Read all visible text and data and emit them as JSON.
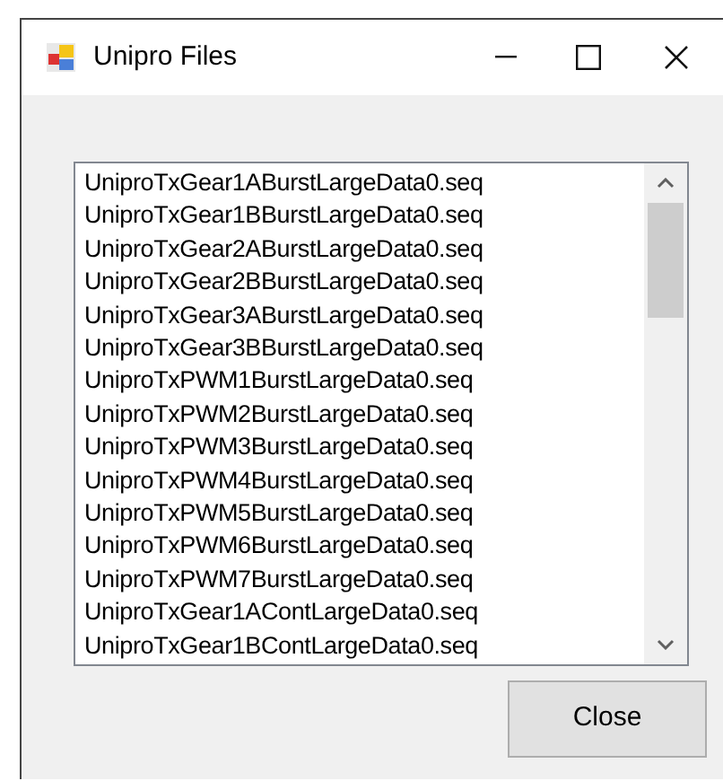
{
  "window": {
    "title": "Unipro Files"
  },
  "files": [
    "UniproTxGear1ABurstLargeData0.seq",
    "UniproTxGear1BBurstLargeData0.seq",
    "UniproTxGear2ABurstLargeData0.seq",
    "UniproTxGear2BBurstLargeData0.seq",
    "UniproTxGear3ABurstLargeData0.seq",
    "UniproTxGear3BBurstLargeData0.seq",
    "UniproTxPWM1BurstLargeData0.seq",
    "UniproTxPWM2BurstLargeData0.seq",
    "UniproTxPWM3BurstLargeData0.seq",
    "UniproTxPWM4BurstLargeData0.seq",
    "UniproTxPWM5BurstLargeData0.seq",
    "UniproTxPWM6BurstLargeData0.seq",
    "UniproTxPWM7BurstLargeData0.seq",
    "UniproTxGear1AContLargeData0.seq",
    "UniproTxGear1BContLargeData0.seq"
  ],
  "buttons": [
    "Close"
  ]
}
